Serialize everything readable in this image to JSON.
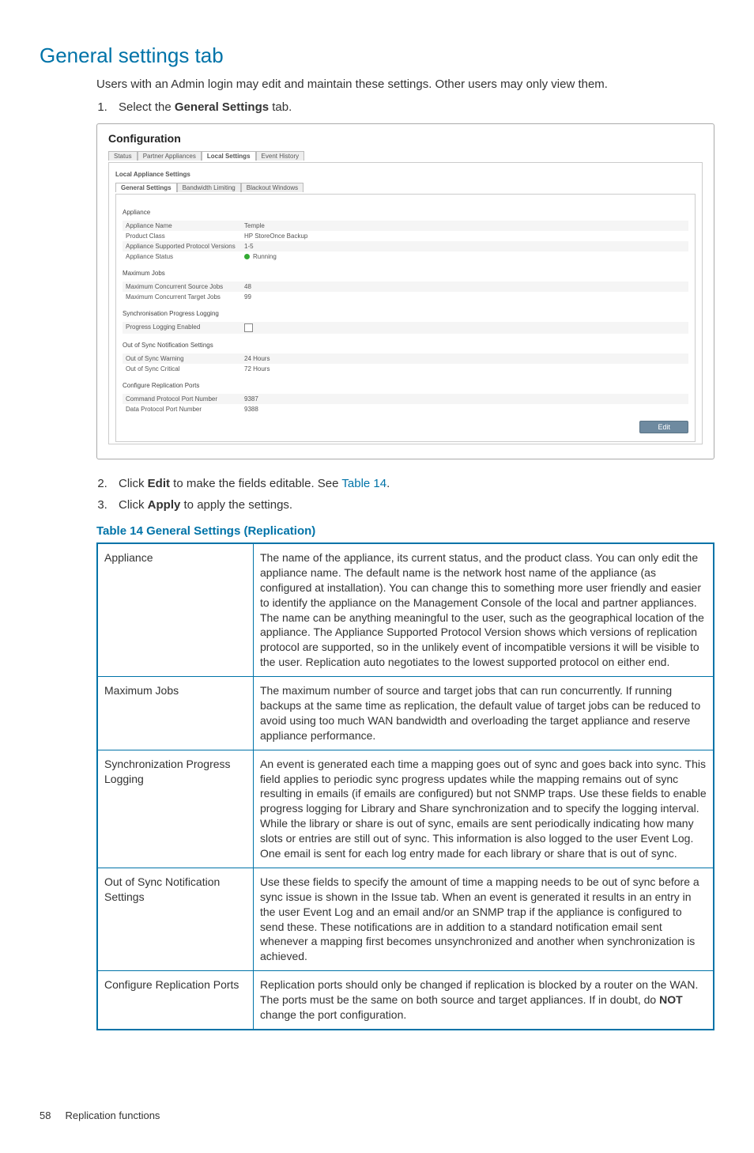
{
  "heading": "General settings tab",
  "intro": "Users with an Admin login may edit and maintain these settings. Other users may only view them.",
  "steps": {
    "s1_a": "Select the ",
    "s1_b": "General Settings",
    "s1_c": " tab.",
    "s2_a": "Click ",
    "s2_b": "Edit",
    "s2_c": " to make the fields editable. See ",
    "s2_link": "Table 14",
    "s2_d": ".",
    "s3_a": "Click ",
    "s3_b": "Apply",
    "s3_c": " to apply the settings."
  },
  "panel": {
    "title": "Configuration",
    "tabs_top": [
      "Status",
      "Partner Appliances",
      "Local Settings",
      "Event History"
    ],
    "tabs_top_active": 2,
    "subsection_label": "Local Appliance Settings",
    "tabs_inner": [
      "General Settings",
      "Bandwidth Limiting",
      "Blackout Windows"
    ],
    "tabs_inner_active": 0,
    "group_appliance": "Appliance",
    "appliance_rows": [
      {
        "k": "Appliance Name",
        "v": "Temple"
      },
      {
        "k": "Product Class",
        "v": "HP StoreOnce Backup"
      },
      {
        "k": "Appliance Supported Protocol Versions",
        "v": "1-5"
      },
      {
        "k": "Appliance Status",
        "v": "Running",
        "status": true
      }
    ],
    "group_maxjobs": "Maximum Jobs",
    "maxjobs_rows": [
      {
        "k": "Maximum Concurrent Source Jobs",
        "v": "48"
      },
      {
        "k": "Maximum Concurrent Target Jobs",
        "v": "99"
      }
    ],
    "group_sync": "Synchronisation Progress Logging",
    "sync_rows": [
      {
        "k": "Progress Logging Enabled",
        "checkbox": true
      }
    ],
    "group_oos": "Out of Sync Notification Settings",
    "oos_rows": [
      {
        "k": "Out of Sync Warning",
        "v": "24 Hours"
      },
      {
        "k": "Out of Sync Critical",
        "v": "72 Hours"
      }
    ],
    "group_ports": "Configure Replication Ports",
    "ports_rows": [
      {
        "k": "Command Protocol Port Number",
        "v": "9387"
      },
      {
        "k": "Data Protocol Port Number",
        "v": "9388"
      }
    ],
    "edit_button": "Edit"
  },
  "table_title": "Table 14 General Settings (Replication)",
  "table": [
    {
      "label": "Appliance",
      "text": "The name of the appliance, its current status, and the product class. You can only edit the appliance name. The default name is the network host name of the appliance (as configured at installation). You can change this to something more user friendly and easier to identify the appliance on the Management Console of the local and partner appliances. The name can be anything meaningful to the user, such as the geographical location of the appliance. The Appliance Supported Protocol Version shows which versions of replication protocol are supported, so in the unlikely event of incompatible versions it will be visible to the user. Replication auto negotiates to the lowest supported protocol on either end."
    },
    {
      "label": "Maximum Jobs",
      "text": "The maximum number of source and target jobs that can run concurrently. If running backups at the same time as replication, the default value of target jobs can be reduced to avoid using too much WAN bandwidth and overloading the target appliance and reserve appliance performance."
    },
    {
      "label": "Synchronization Progress Logging",
      "text": "An event is generated each time a mapping goes out of sync and goes back into sync. This field applies to periodic sync progress updates while the mapping remains out of sync resulting in emails (if emails are configured) but not SNMP traps. Use these fields to enable progress logging for Library and Share synchronization and to specify the logging interval. While the library or share is out of sync, emails are sent periodically indicating how many slots or entries are still out of sync. This information is also logged to the user Event Log. One email is sent for each log entry made for each library or share that is out of sync."
    },
    {
      "label": "Out of Sync Notification Settings",
      "text": "Use these fields to specify the amount of time a mapping needs to be out of sync before a sync issue is shown in the Issue tab. When an event is generated it results in an entry in the user Event Log and an email and/or an SNMP trap if the appliance is configured to send these. These notifications are in addition to a standard notification email sent whenever a mapping first becomes unsynchronized and another when synchronization is achieved."
    },
    {
      "label": "Configure Replication Ports",
      "text_a": "Replication ports should only be changed if replication is blocked by a router on the WAN. The ports must be the same on both source and target appliances. If in doubt, do ",
      "text_b": "NOT",
      "text_c": " change the port configuration."
    }
  ],
  "footer": {
    "page": "58",
    "section": "Replication functions"
  }
}
